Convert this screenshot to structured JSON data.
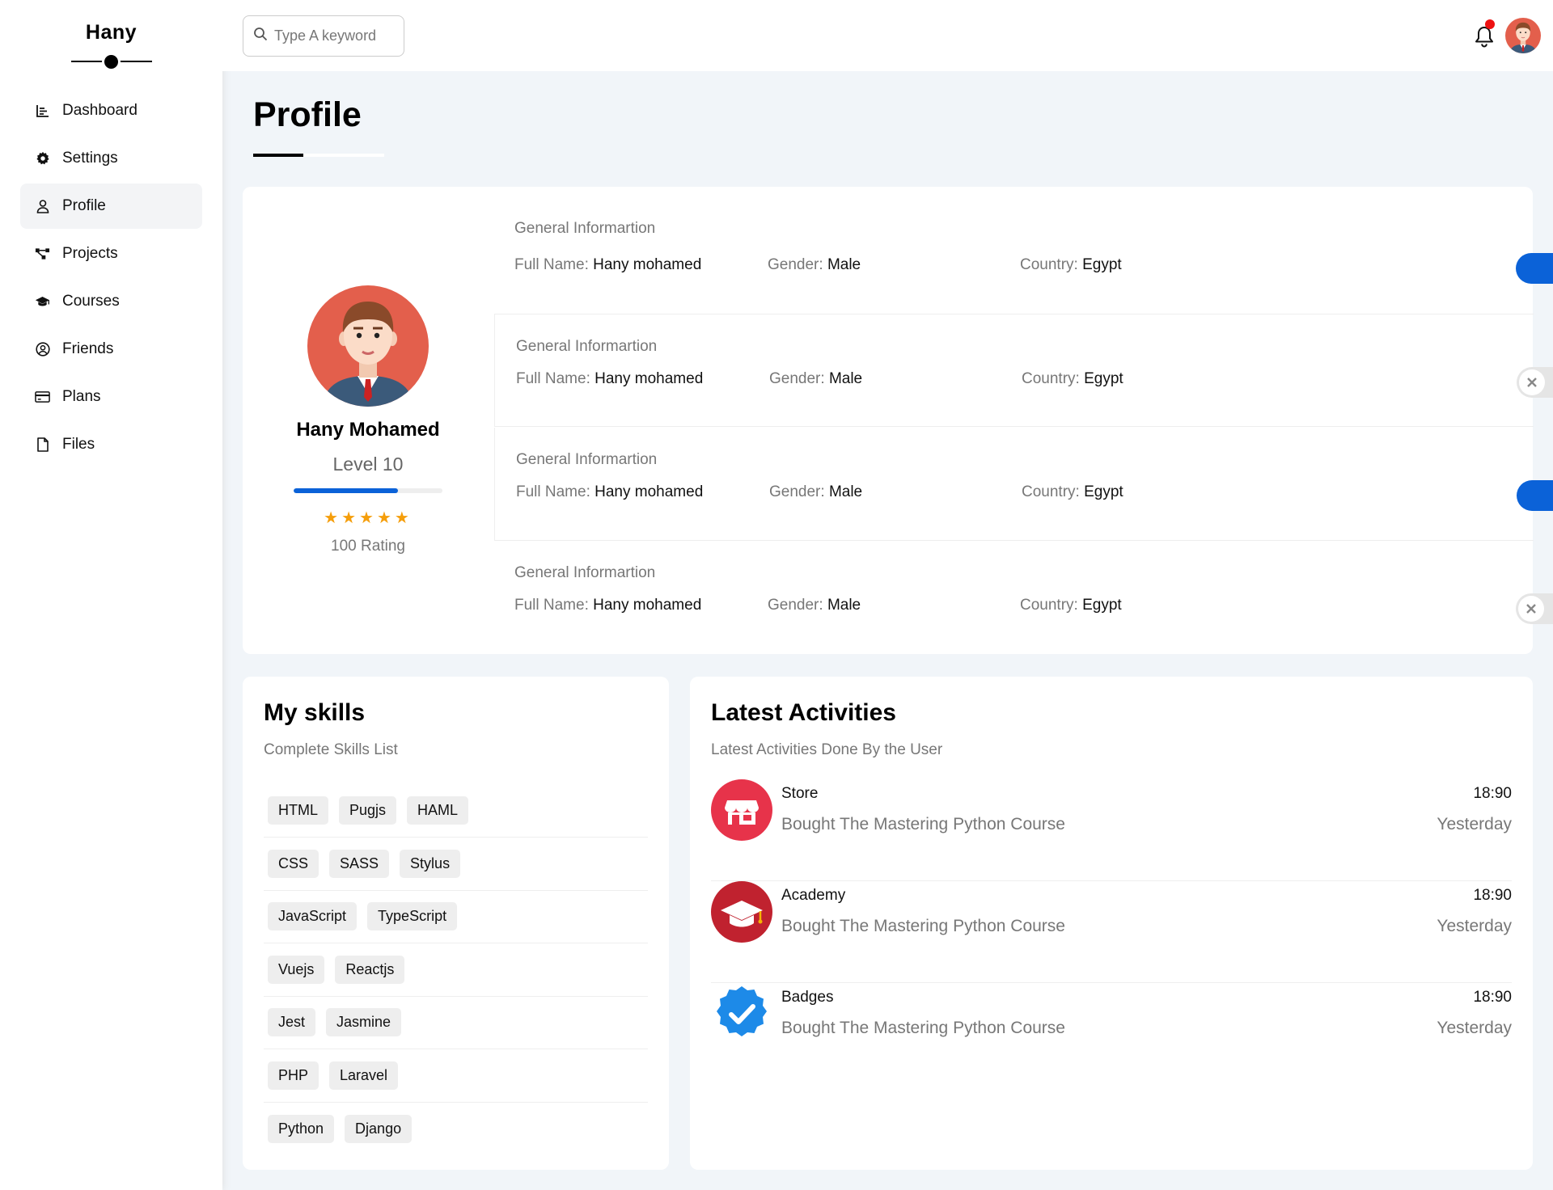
{
  "sidebar": {
    "brand": "Hany",
    "items": [
      {
        "label": "Dashboard",
        "icon": "chart-icon"
      },
      {
        "label": "Settings",
        "icon": "gear-icon"
      },
      {
        "label": "Profile",
        "icon": "user-icon",
        "active": true
      },
      {
        "label": "Projects",
        "icon": "diagram-icon"
      },
      {
        "label": "Courses",
        "icon": "graduation-cap-icon"
      },
      {
        "label": "Friends",
        "icon": "user-circle-icon"
      },
      {
        "label": "Plans",
        "icon": "credit-card-icon"
      },
      {
        "label": "Files",
        "icon": "file-icon"
      }
    ]
  },
  "header": {
    "search_placeholder": "Type A keyword",
    "has_notification": true
  },
  "page": {
    "title": "Profile"
  },
  "profile": {
    "name": "Hany Mohamed",
    "level": "Level 10",
    "level_progress": 0.7,
    "stars": 5,
    "rating": "100 Rating",
    "rows": [
      {
        "title": "General Informartion",
        "full_name_label": "Full Name:",
        "full_name": "Hany mohamed",
        "gender_label": "Gender:",
        "gender": "Male",
        "country_label": "Country:",
        "country": "Egypt",
        "toggle": "on"
      },
      {
        "title": "General Informartion",
        "full_name_label": "Full Name:",
        "full_name": "Hany mohamed",
        "gender_label": "Gender:",
        "gender": "Male",
        "country_label": "Country:",
        "country": "Egypt",
        "toggle": "off"
      },
      {
        "title": "General Informartion",
        "full_name_label": "Full Name:",
        "full_name": "Hany mohamed",
        "gender_label": "Gender:",
        "gender": "Male",
        "country_label": "Country:",
        "country": "Egypt",
        "toggle": "on"
      },
      {
        "title": "General Informartion",
        "full_name_label": "Full Name:",
        "full_name": "Hany mohamed",
        "gender_label": "Gender:",
        "gender": "Male",
        "country_label": "Country:",
        "country": "Egypt",
        "toggle": "off"
      }
    ]
  },
  "skills": {
    "title": "My skills",
    "subtitle": "Complete Skills List",
    "rows": [
      [
        "HTML",
        "Pugjs",
        "HAML"
      ],
      [
        "CSS",
        "SASS",
        "Stylus"
      ],
      [
        "JavaScript",
        "TypeScript"
      ],
      [
        "Vuejs",
        "Reactjs"
      ],
      [
        "Jest",
        "Jasmine"
      ],
      [
        "PHP",
        "Laravel"
      ],
      [
        "Python",
        "Django"
      ]
    ]
  },
  "activities": {
    "title": "Latest Activities",
    "subtitle": "Latest Activities Done By the User",
    "items": [
      {
        "title": "Store",
        "desc": "Bought The Mastering Python Course",
        "time": "18:90",
        "date": "Yesterday",
        "icon": "store-icon",
        "color": "#e7334a"
      },
      {
        "title": "Academy",
        "desc": "Bought The Mastering Python Course",
        "time": "18:90",
        "date": "Yesterday",
        "icon": "academy-icon",
        "color": "#c0222f"
      },
      {
        "title": "Badges",
        "desc": "Bought The Mastering Python Course",
        "time": "18:90",
        "date": "Yesterday",
        "icon": "badge-check-icon",
        "color": "#1d8ae8"
      }
    ]
  },
  "colors": {
    "accent": "#0b62d8",
    "star": "#f59e0b",
    "notification": "#e11111"
  }
}
